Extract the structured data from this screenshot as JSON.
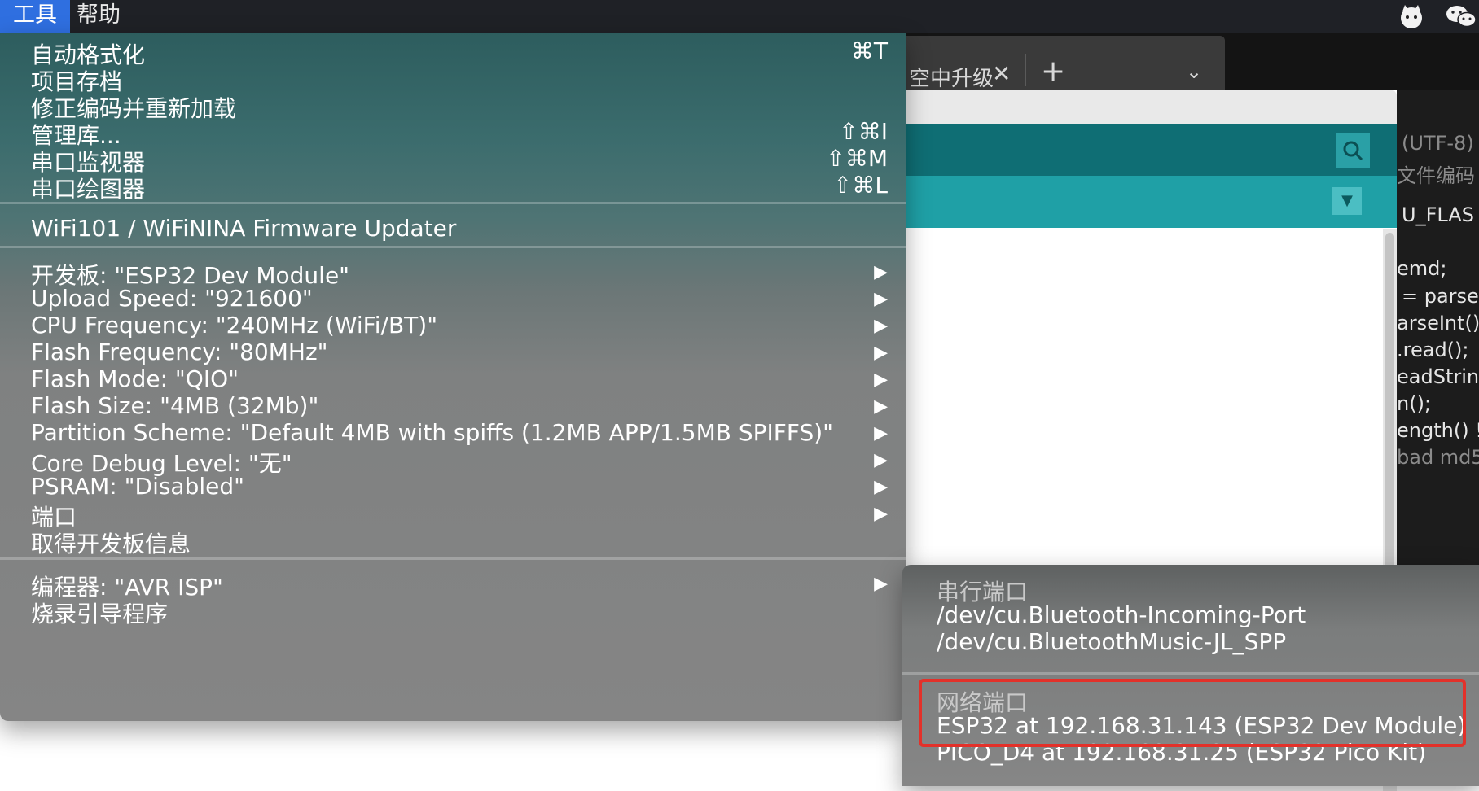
{
  "menubar": {
    "items": [
      {
        "label": "工具",
        "active": true
      },
      {
        "label": "帮助",
        "active": false
      }
    ],
    "right_icons": [
      "cat-face-icon",
      "wechat-icon"
    ]
  },
  "background": {
    "tab_title": "空中升级",
    "tab_close": "✕",
    "tab_add": "+",
    "tab_chevron": "⌄",
    "serial_monitor_icon": "magnifier-icon",
    "tabs_menu_icon": "▼",
    "editor_lines": [
      {
        "text": "(UTF-8)",
        "muted": true
      },
      {
        "text": "文件编码",
        "muted": true
      },
      {
        "text": "U_FLAS",
        "muted": false
      },
      {
        "text": "emd;",
        "muted": false
      },
      {
        "text": "= parseI",
        "muted": false
      },
      {
        "text": "arseInt();",
        "muted": false
      },
      {
        "text": ".read();",
        "muted": false
      },
      {
        "text": "eadString",
        "muted": false
      },
      {
        "text": "n();",
        "muted": false
      },
      {
        "text": "ength() !=",
        "muted": false
      },
      {
        "text": "bad md5",
        "muted": true
      }
    ]
  },
  "tools_menu": {
    "items": [
      {
        "label": "自动格式化",
        "shortcut": "⌘T"
      },
      {
        "label": "项目存档",
        "shortcut": ""
      },
      {
        "label": "修正编码并重新加载",
        "shortcut": ""
      },
      {
        "label": "管理库...",
        "shortcut": "⇧⌘I"
      },
      {
        "label": "串口监视器",
        "shortcut": "⇧⌘M"
      },
      {
        "label": "串口绘图器",
        "shortcut": "⇧⌘L"
      },
      {
        "label": "WiFi101 / WiFiNINA Firmware Updater",
        "shortcut": ""
      },
      {
        "label": "开发板: \"ESP32 Dev Module\"",
        "submenu": true
      },
      {
        "label": "Upload Speed: \"921600\"",
        "submenu": true
      },
      {
        "label": "CPU Frequency: \"240MHz (WiFi/BT)\"",
        "submenu": true
      },
      {
        "label": "Flash Frequency: \"80MHz\"",
        "submenu": true
      },
      {
        "label": "Flash Mode: \"QIO\"",
        "submenu": true
      },
      {
        "label": "Flash Size: \"4MB (32Mb)\"",
        "submenu": true
      },
      {
        "label": "Partition Scheme: \"Default 4MB with spiffs (1.2MB APP/1.5MB SPIFFS)\"",
        "submenu": true
      },
      {
        "label": "Core Debug Level: \"无\"",
        "submenu": true
      },
      {
        "label": "PSRAM: \"Disabled\"",
        "submenu": true
      },
      {
        "label": "端口",
        "submenu": true
      },
      {
        "label": "取得开发板信息",
        "submenu": false
      },
      {
        "label": "编程器: \"AVR ISP\"",
        "submenu": true
      },
      {
        "label": "烧录引导程序",
        "submenu": false
      }
    ],
    "submenu_arrow": "▶"
  },
  "port_menu": {
    "serial_header": "串行端口",
    "serial_ports": [
      "/dev/cu.Bluetooth-Incoming-Port",
      "/dev/cu.BluetoothMusic-JL_SPP"
    ],
    "network_header": "网络端口",
    "network_ports": [
      "ESP32 at 192.168.31.143 (ESP32 Dev Module)",
      "PICO_D4 at 192.168.31.25 (ESP32 Pico Kit)"
    ],
    "highlight_color": "#e3312a"
  }
}
